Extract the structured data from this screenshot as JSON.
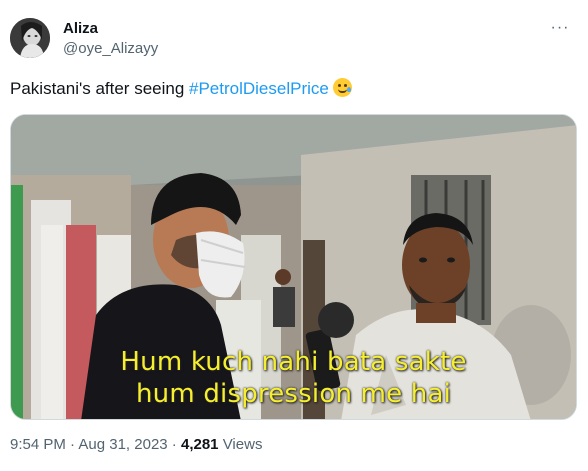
{
  "author": {
    "display_name": "Aliza",
    "handle": "@oye_Alizayy"
  },
  "menu": {
    "more_icon": "more-horizontal-icon",
    "more_glyph": "···"
  },
  "tweet": {
    "text_prefix": "Pakistani's after seeing ",
    "hashtag": "#PetrolDieselPrice",
    "emoji": "face-holding-back-tears-emoji"
  },
  "media": {
    "caption_line1": "Hum kuch nahi bata sakte",
    "caption_line2": "hum dispression me hai",
    "caption_color": "#f6ef2e"
  },
  "meta": {
    "time": "9:54 PM",
    "separator": " · ",
    "date": "Aug 31, 2023",
    "views_count": "4,281",
    "views_label": " Views"
  },
  "colors": {
    "text_primary": "#0f1419",
    "text_secondary": "#536471",
    "link": "#1d9bf0"
  }
}
